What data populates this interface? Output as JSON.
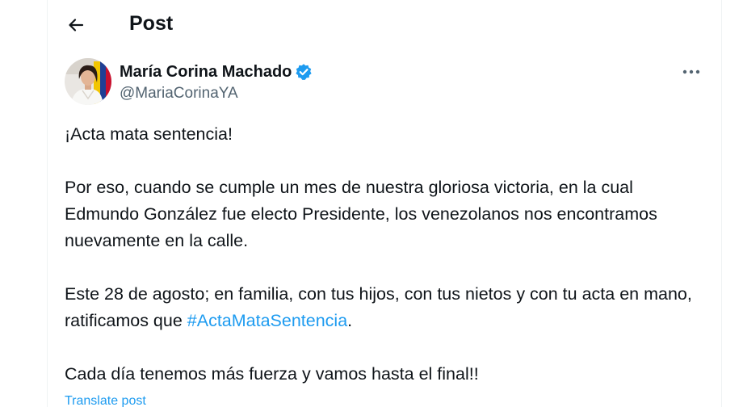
{
  "header": {
    "title": "Post",
    "back_icon": "arrow-left-icon"
  },
  "author": {
    "display_name": "María Corina Machado",
    "handle": "@MariaCorinaYA",
    "verified": true,
    "verified_icon": "verified-badge-icon",
    "verified_color": "#1d9bf0"
  },
  "more_icon": "more-horizontal-icon",
  "tweet": {
    "line1": "¡Acta mata sentencia!",
    "paragraph2": "Por eso, cuando se cumple un mes de nuestra gloriosa victoria, en la cual Edmundo González fue electo Presidente, los venezolanos nos encontramos nuevamente en la calle.",
    "paragraph3_before": "Este 28 de agosto; en familia, con tus hijos, con tus nietos y con tu acta en mano, ratificamos que ",
    "hashtag": "#ActaMataSentencia",
    "paragraph3_after": ".",
    "paragraph4": "Cada día tenemos más fuerza y vamos hasta el final!!"
  },
  "translate_label": "Translate post",
  "colors": {
    "accent": "#1d9bf0",
    "text": "#0f1419",
    "secondary": "#536471"
  }
}
